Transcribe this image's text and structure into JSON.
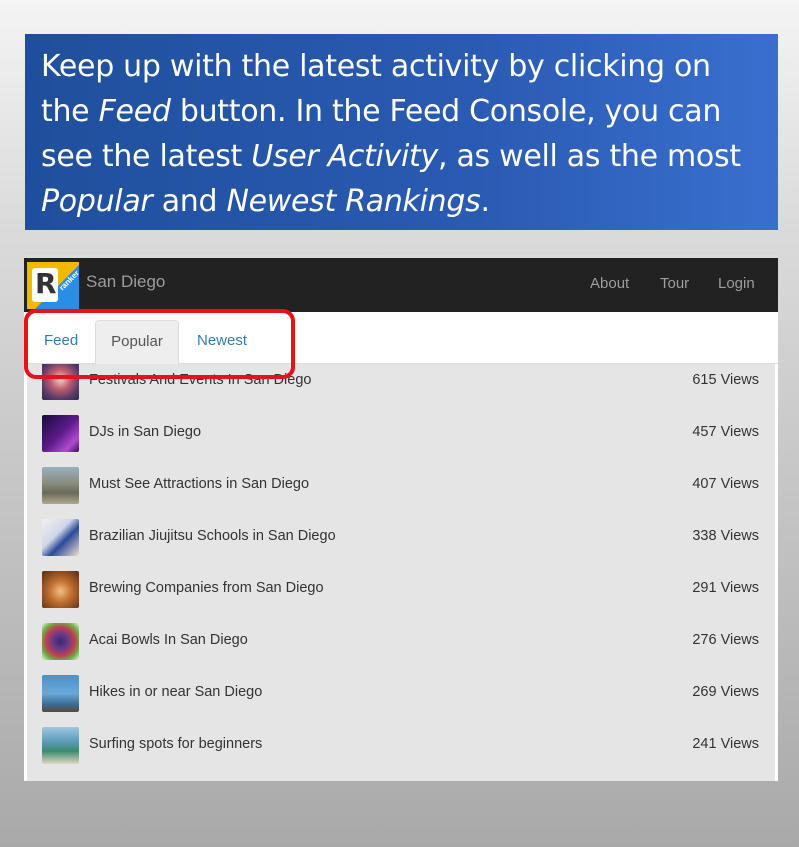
{
  "banner": {
    "line1": "Keep up with the latest activity by clicking on",
    "line2_pre": "the ",
    "line2_em": "Feed",
    "line2_post": " button. In the Feed Console, you can",
    "line3_pre": "see the latest ",
    "line3_em": "User Activity",
    "line3_post": ",  as well as the most",
    "line4_em1": "Popular",
    "line4_mid": " and ",
    "line4_em2": "Newest Rankings",
    "line4_post": "."
  },
  "navbar": {
    "logo_letter": "R",
    "logo_sub": "ranker",
    "brand": "San Diego",
    "links": [
      "About",
      "Tour",
      "Login"
    ]
  },
  "tabs": [
    {
      "label": "Feed",
      "active": false
    },
    {
      "label": "Popular",
      "active": true
    },
    {
      "label": "Newest",
      "active": false
    }
  ],
  "rankings": [
    {
      "title": "Festivals And Events In San Diego",
      "views": "615 Views"
    },
    {
      "title": "DJs in San Diego",
      "views": "457 Views"
    },
    {
      "title": "Must See Attractions in San Diego",
      "views": "407 Views"
    },
    {
      "title": "Brazilian Jiujitsu Schools in San Diego",
      "views": "338 Views"
    },
    {
      "title": "Brewing Companies from San Diego",
      "views": "291 Views"
    },
    {
      "title": "Acai Bowls In San Diego",
      "views": "276 Views"
    },
    {
      "title": "Hikes in or near San Diego",
      "views": "269 Views"
    },
    {
      "title": "Surfing spots for beginners",
      "views": "241 Views"
    }
  ],
  "colors": {
    "banner_bg": "#2a5bb3",
    "navbar_bg": "#222222",
    "link": "#337ab7",
    "highlight": "#e8101a",
    "list_bg": "#e5e5e5"
  }
}
